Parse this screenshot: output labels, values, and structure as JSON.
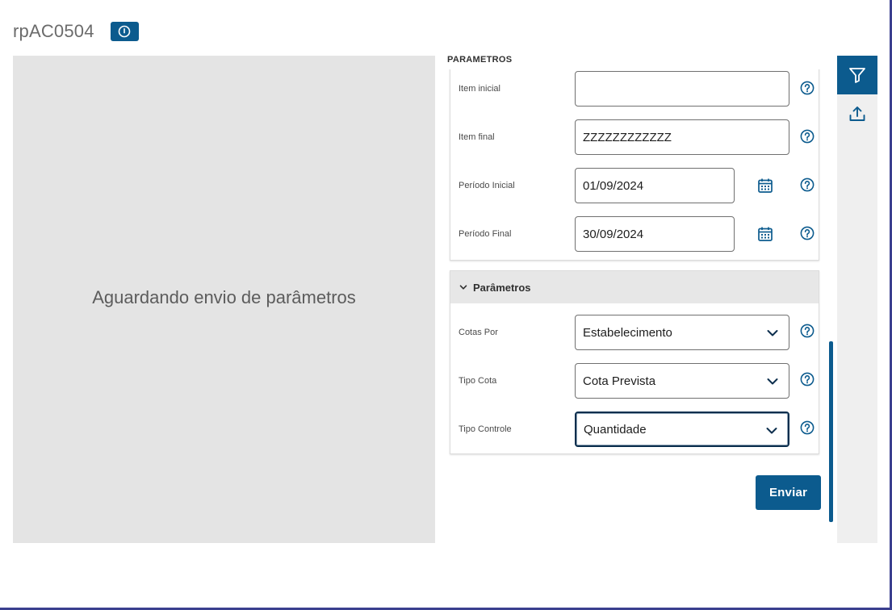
{
  "header": {
    "title": "rpAC0504",
    "info_icon": "info-circle-icon"
  },
  "preview": {
    "message": "Aguardando envio de parâmetros"
  },
  "params": {
    "section_label": "PARAMETROS",
    "fields": [
      {
        "label": "Item inicial",
        "value": ""
      },
      {
        "label": "Item final",
        "value": "ZZZZZZZZZZZZ"
      },
      {
        "label": "Período Inicial",
        "value": "01/09/2024",
        "icon": "calendar-icon"
      },
      {
        "label": "Período Final",
        "value": "30/09/2024",
        "icon": "calendar-icon"
      }
    ],
    "group": {
      "title": "Parâmetros",
      "selects": [
        {
          "label": "Cotas Por",
          "value": "Estabelecimento"
        },
        {
          "label": "Tipo Cota",
          "value": "Cota Prevista"
        },
        {
          "label": "Tipo Controle",
          "value": "Quantidade"
        }
      ]
    },
    "submit_label": "Enviar"
  },
  "sidebar": {
    "icons": [
      "filter-icon",
      "upload-icon"
    ]
  },
  "colors": {
    "primary": "#0c5b8e",
    "preview_bg": "#e4e4e4",
    "frame": "#3b3f8f",
    "group_header": "#e7e7e7"
  }
}
